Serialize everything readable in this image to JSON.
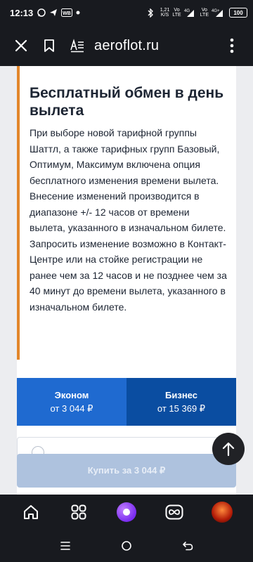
{
  "status_bar": {
    "time": "12:13",
    "net_speed_value": "1,21",
    "net_speed_unit": "K/S",
    "sim1_label": "Vo\nLTE",
    "sim1_gen": "4G",
    "sim2_label": "Vo\nLTE",
    "sim2_gen": "4G+",
    "battery": "100",
    "notif_badge": "WB"
  },
  "toolbar": {
    "url": "aeroflot.ru"
  },
  "card": {
    "title": "Бесплатный обмен в день вылета",
    "paragraphs": [
      "При выборе новой тарифной группы Шаттл, а также тарифных групп Базовый, Оптимум, Максимум включена опция бесплатного изменения времени вылета.",
      "Внесение изменений производится в диапазоне +/- 12 часов от времени вылета, указанного в изначальном билете.",
      "Запросить изменение возможно в Контакт-Центре или на стойке регистрации не ранее чем за 12 часов и не позднее чем за 40 минут до времени вылета, указанного в изначальном билете."
    ]
  },
  "fares": [
    {
      "name": "Эконом",
      "price": "от 3 044 ₽",
      "selected": true
    },
    {
      "name": "Бизнес",
      "price": "от 15 369 ₽",
      "selected": false
    }
  ],
  "buy_button": {
    "label": "Купить за 3 044 ₽"
  },
  "icons": {
    "close": "close-icon",
    "bookmark": "bookmark-icon",
    "reader": "reader-mode-icon",
    "menu": "more-vertical-icon",
    "scroll_top": "arrow-up-icon",
    "home": "home-icon",
    "tabs": "tabs-grid-icon",
    "alice": "alice-assistant-icon",
    "infinity": "infinity-icon",
    "profile": "profile-avatar"
  },
  "colors": {
    "accent": "#e2862b",
    "economy": "#1f6ad0",
    "business": "#0a4da1",
    "buy_disabled": "#aec2de"
  }
}
